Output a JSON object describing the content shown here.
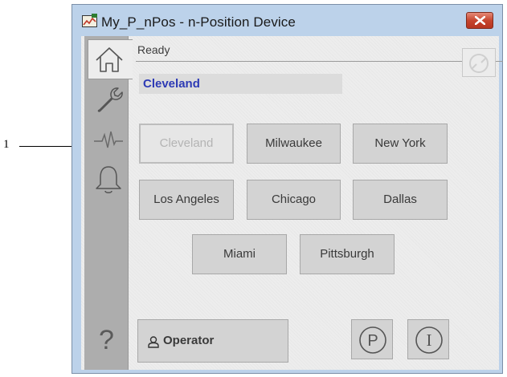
{
  "callout": {
    "number": "1"
  },
  "window": {
    "title": "My_P_nPos - n-Position Device",
    "close_icon": "close-x-icon"
  },
  "sidebar": {
    "tabs": [
      {
        "name": "home",
        "icon": "home-icon",
        "active": true
      },
      {
        "name": "maintenance",
        "icon": "wrench-icon",
        "active": false
      },
      {
        "name": "trends",
        "icon": "waveform-icon",
        "active": false
      },
      {
        "name": "alarms",
        "icon": "bell-icon",
        "active": false
      }
    ],
    "help_label": "?"
  },
  "status": {
    "text": "Ready",
    "selected_position": "Cleveland",
    "refresh_icon": "refresh-icon"
  },
  "positions": [
    {
      "label": "Cleveland",
      "selected": true
    },
    {
      "label": "Milwaukee",
      "selected": false
    },
    {
      "label": "New York",
      "selected": false
    },
    {
      "label": "Los Angeles",
      "selected": false
    },
    {
      "label": "Chicago",
      "selected": false
    },
    {
      "label": "Dallas",
      "selected": false
    },
    {
      "label": "Miami",
      "selected": false
    },
    {
      "label": "Pittsburgh",
      "selected": false
    }
  ],
  "bottom": {
    "operator_label": "Operator",
    "program_label": "P",
    "interlock_label": "I"
  },
  "colors": {
    "selected_text": "#2d3ab5",
    "close_button": "#c6452e",
    "window_frame": "#bcd2ea"
  }
}
